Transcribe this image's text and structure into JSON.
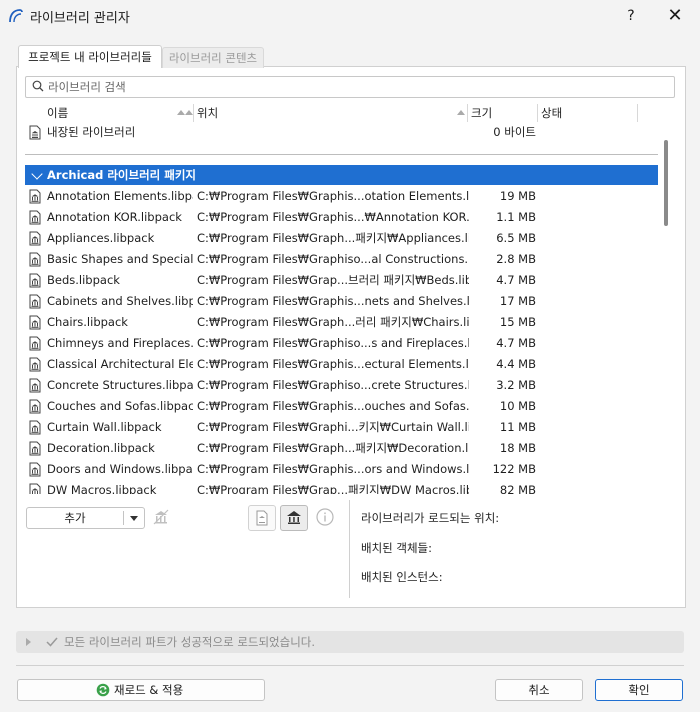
{
  "window": {
    "title": "라이브러리 관리자",
    "help": "?",
    "close": "✕"
  },
  "tabs": [
    {
      "label": "프로젝트 내 라이브러리들",
      "active": true
    },
    {
      "label": "라이브러리 콘텐츠",
      "active": false
    }
  ],
  "search": {
    "placeholder": "라이브러리 검색"
  },
  "columns": {
    "name": "이름",
    "location": "위치",
    "size": "크기",
    "status": "상태"
  },
  "embedded": {
    "name": "내장된 라이브러리",
    "size": "0 바이트"
  },
  "package_group": {
    "label": "Archicad 라이브러리 패키지"
  },
  "rows": [
    {
      "name": "Annotation Elements.libpack",
      "path": "C:₩Program Files₩Graphis...otation Elements.libpack",
      "size": "19 MB"
    },
    {
      "name": "Annotation KOR.libpack",
      "path": "C:₩Program Files₩Graphis...₩Annotation KOR.libpack",
      "size": "1.1 MB"
    },
    {
      "name": "Appliances.libpack",
      "path": "C:₩Program Files₩Graph...패키지₩Appliances.libpack",
      "size": "6.5 MB"
    },
    {
      "name": "Basic Shapes and Special C...",
      "path": "C:₩Program Files₩Graphiso...al Constructions.libpack",
      "size": "2.8 MB"
    },
    {
      "name": "Beds.libpack",
      "path": "C:₩Program Files₩Grap...브러리 패키지₩Beds.libpack",
      "size": "4.7 MB"
    },
    {
      "name": "Cabinets and Shelves.libpa...",
      "path": "C:₩Program Files₩Graphis...nets and Shelves.libpack",
      "size": "17 MB"
    },
    {
      "name": "Chairs.libpack",
      "path": "C:₩Program Files₩Graph...러리 패키지₩Chairs.libpack",
      "size": "15 MB"
    },
    {
      "name": "Chimneys and Fireplaces.lib...",
      "path": "C:₩Program Files₩Graphiso...s and Fireplaces.libpack",
      "size": "4.7 MB"
    },
    {
      "name": "Classical Architectural Elem...",
      "path": "C:₩Program Files₩Graphis...ectural Elements.libpack",
      "size": "4.4 MB"
    },
    {
      "name": "Concrete Structures.libpack",
      "path": "C:₩Program Files₩Graphiso...crete Structures.libpack",
      "size": "3.2 MB"
    },
    {
      "name": "Couches and Sofas.libpack",
      "path": "C:₩Program Files₩Graphis...ouches and Sofas.libpack",
      "size": "10 MB"
    },
    {
      "name": "Curtain Wall.libpack",
      "path": "C:₩Program Files₩Graphi...키지₩Curtain Wall.libpack",
      "size": "11 MB"
    },
    {
      "name": "Decoration.libpack",
      "path": "C:₩Program Files₩Graph...패키지₩Decoration.libpack",
      "size": "18 MB"
    },
    {
      "name": "Doors and Windows.libpack",
      "path": "C:₩Program Files₩Graphis...ors and Windows.libpack",
      "size": "122 MB"
    },
    {
      "name": "DW Macros.libpack",
      "path": "C:₩Program Files₩Grap...패키지₩DW Macros.libpack",
      "size": "82 MB"
    }
  ],
  "controls": {
    "add": "추가"
  },
  "info": {
    "load_location": "라이브러리가 로드되는 위치:",
    "placed_objects": "배치된 객체들:",
    "placed_instances": "배치된 인스턴스:"
  },
  "status": {
    "message": "모든 라이브러리 파트가 성공적으로 로드되었습니다."
  },
  "buttons": {
    "reload": "재로드 & 적용",
    "cancel": "취소",
    "ok": "확인"
  },
  "colors": {
    "selection": "#1f6fd1",
    "accent": "#1f6fd1"
  }
}
